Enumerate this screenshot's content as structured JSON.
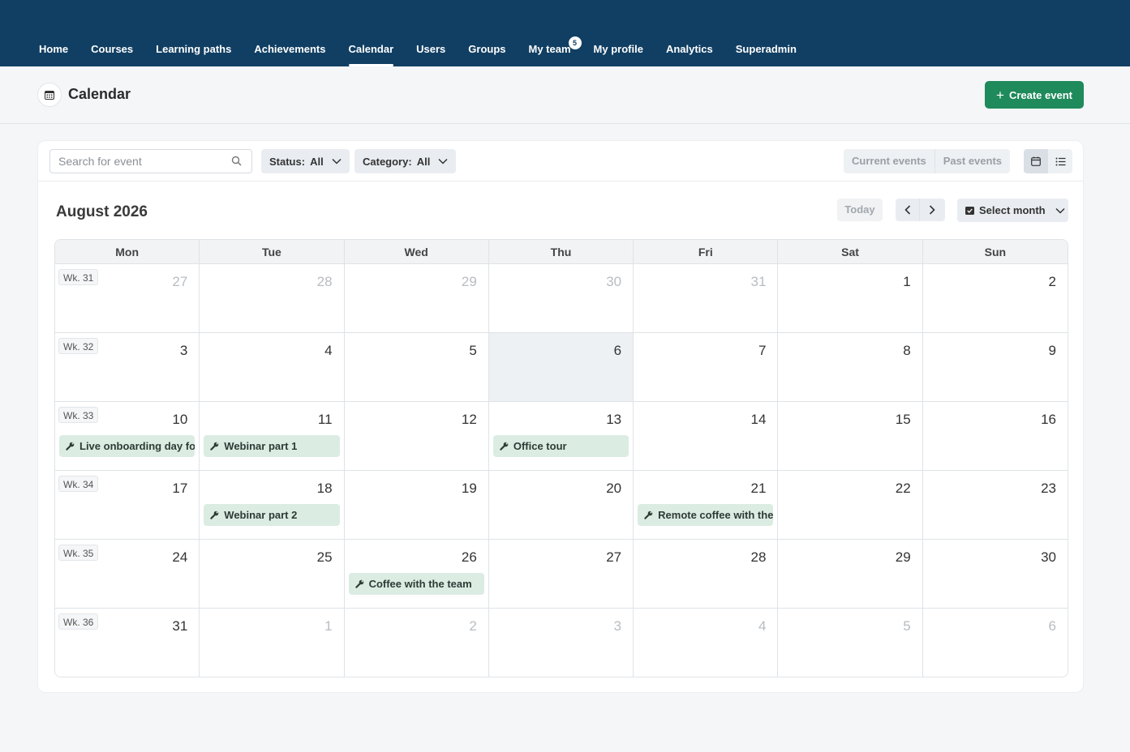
{
  "nav": {
    "items": [
      {
        "label": "Home",
        "active": false
      },
      {
        "label": "Courses",
        "active": false
      },
      {
        "label": "Learning paths",
        "active": false
      },
      {
        "label": "Achievements",
        "active": false
      },
      {
        "label": "Calendar",
        "active": true
      },
      {
        "label": "Users",
        "active": false
      },
      {
        "label": "Groups",
        "active": false
      },
      {
        "label": "My team",
        "active": false,
        "badge": "5"
      },
      {
        "label": "My profile",
        "active": false
      },
      {
        "label": "Analytics",
        "active": false
      },
      {
        "label": "Superadmin",
        "active": false
      }
    ]
  },
  "header": {
    "title": "Calendar",
    "icon": "calendar-icon",
    "create_label": "Create event"
  },
  "toolbar": {
    "search_placeholder": "Search for event",
    "status_label": "Status:",
    "status_value": "All",
    "category_label": "Category:",
    "category_value": "All",
    "current_events": "Current events",
    "past_events": "Past events"
  },
  "calendar": {
    "month_title": "August 2026",
    "today_label": "Today",
    "select_month_label": "Select month",
    "weekdays": [
      "Mon",
      "Tue",
      "Wed",
      "Thu",
      "Fri",
      "Sat",
      "Sun"
    ],
    "weeks": [
      {
        "label": "Wk. 31",
        "days": [
          {
            "num": "27",
            "other": true
          },
          {
            "num": "28",
            "other": true
          },
          {
            "num": "29",
            "other": true
          },
          {
            "num": "30",
            "other": true
          },
          {
            "num": "31",
            "other": true
          },
          {
            "num": "1"
          },
          {
            "num": "2"
          }
        ]
      },
      {
        "label": "Wk. 32",
        "days": [
          {
            "num": "3"
          },
          {
            "num": "4"
          },
          {
            "num": "5"
          },
          {
            "num": "6",
            "today": true
          },
          {
            "num": "7"
          },
          {
            "num": "8"
          },
          {
            "num": "9"
          }
        ]
      },
      {
        "label": "Wk. 33",
        "days": [
          {
            "num": "10",
            "event": "Live onboarding day for"
          },
          {
            "num": "11",
            "event": "Webinar part 1"
          },
          {
            "num": "12"
          },
          {
            "num": "13",
            "event": "Office tour"
          },
          {
            "num": "14"
          },
          {
            "num": "15"
          },
          {
            "num": "16"
          }
        ]
      },
      {
        "label": "Wk. 34",
        "days": [
          {
            "num": "17"
          },
          {
            "num": "18",
            "event": "Webinar part 2"
          },
          {
            "num": "19"
          },
          {
            "num": "20"
          },
          {
            "num": "21",
            "event": "Remote coffee with the"
          },
          {
            "num": "22"
          },
          {
            "num": "23"
          }
        ]
      },
      {
        "label": "Wk. 35",
        "days": [
          {
            "num": "24"
          },
          {
            "num": "25"
          },
          {
            "num": "26",
            "event": "Coffee with the team"
          },
          {
            "num": "27"
          },
          {
            "num": "28"
          },
          {
            "num": "29"
          },
          {
            "num": "30"
          }
        ]
      },
      {
        "label": "Wk. 36",
        "days": [
          {
            "num": "31"
          },
          {
            "num": "1",
            "other": true
          },
          {
            "num": "2",
            "other": true
          },
          {
            "num": "3",
            "other": true
          },
          {
            "num": "4",
            "other": true
          },
          {
            "num": "5",
            "other": true
          },
          {
            "num": "6",
            "other": true
          }
        ]
      }
    ]
  },
  "colors": {
    "nav_bg": "#113f63",
    "accent": "#1f8a5b",
    "event_bg": "#dbece3",
    "today_bg": "#edf1f4"
  }
}
